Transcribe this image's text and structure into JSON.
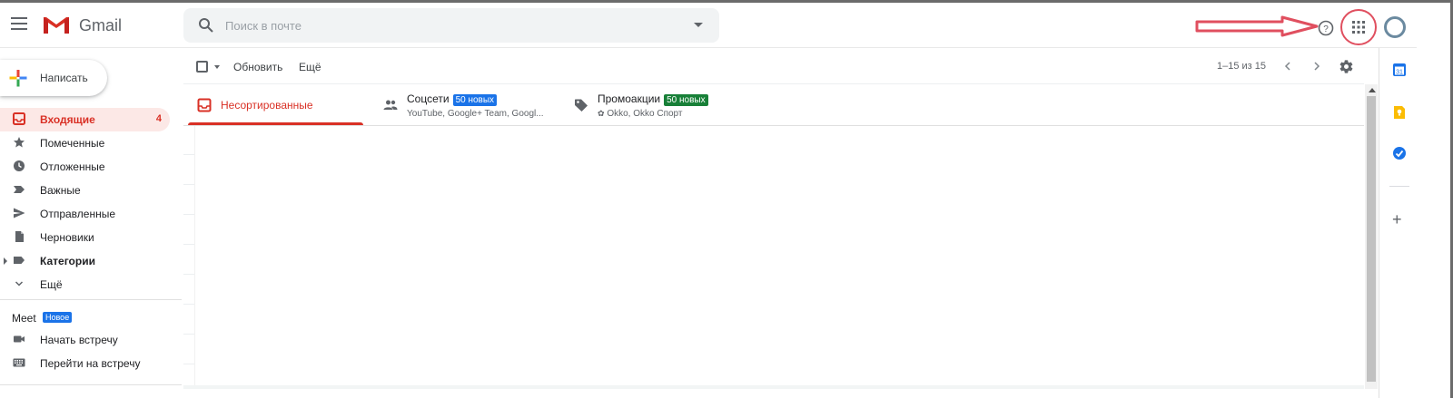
{
  "header": {
    "app_name": "Gmail",
    "search_placeholder": "Поиск в почте"
  },
  "sidebar": {
    "compose_label": "Написать",
    "items": [
      {
        "label": "Входящие",
        "count": "4",
        "icon": "inbox-icon",
        "active": true
      },
      {
        "label": "Помеченные",
        "icon": "star-icon"
      },
      {
        "label": "Отложенные",
        "icon": "clock-icon"
      },
      {
        "label": "Важные",
        "icon": "important-icon"
      },
      {
        "label": "Отправленные",
        "icon": "send-icon"
      },
      {
        "label": "Черновики",
        "icon": "draft-icon"
      },
      {
        "label": "Категории",
        "icon": "label-icon",
        "bold": true
      },
      {
        "label": "Ещё",
        "icon": "chevron-down-icon"
      }
    ],
    "meet": {
      "title": "Meet",
      "badge": "Новое",
      "items": [
        {
          "label": "Начать встречу",
          "icon": "video-icon"
        },
        {
          "label": "Перейти на встречу",
          "icon": "keyboard-icon"
        }
      ]
    }
  },
  "toolbar": {
    "refresh_label": "Обновить",
    "more_label": "Ещё",
    "pagination": "1–15 из 15"
  },
  "tabs": [
    {
      "name": "Несортированные",
      "icon": "inbox-icon",
      "active": true
    },
    {
      "name": "Соцсети",
      "badge": "50 новых",
      "badge_color": "#1a73e8",
      "subtitle": "YouTube, Google+ Team, Googl...",
      "icon": "people-icon"
    },
    {
      "name": "Промоакции",
      "badge": "50 новых",
      "badge_color": "#188038",
      "subtitle": "Okko, Okko Спорт",
      "icon": "tag-icon"
    }
  ],
  "colors": {
    "accent_red": "#d93025",
    "annotation_red": "#e04f5f"
  }
}
